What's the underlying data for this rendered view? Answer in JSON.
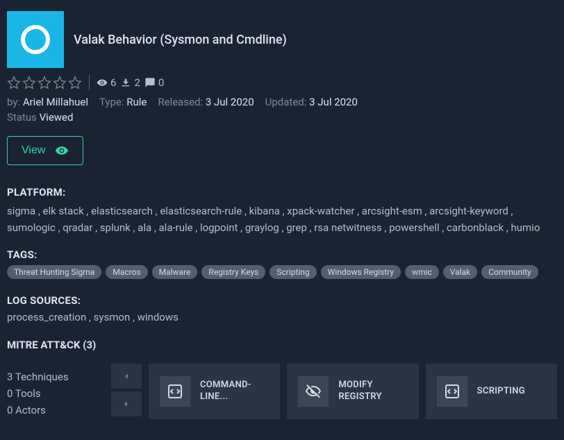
{
  "title": "Valak Behavior (Sysmon and Cmdline)",
  "rating": 0,
  "stats": {
    "views": "6",
    "downloads": "2",
    "comments": "0"
  },
  "meta": {
    "by_label": "by:",
    "author": "Ariel Millahuel",
    "type_label": "Type:",
    "type": "Rule",
    "released_label": "Released:",
    "released": "3 Jul 2020",
    "updated_label": "Updated:",
    "updated": "3 Jul 2020",
    "status_label": "Status",
    "status": "Viewed"
  },
  "view_btn": "View",
  "platform": {
    "label": "PLATFORM:",
    "text": "sigma , elk stack , elasticsearch , elasticsearch-rule , kibana , xpack-watcher , arcsight-esm , arcsight-keyword , sumologic , qradar , splunk , ala , ala-rule , logpoint , graylog , grep , rsa netwitness , powershell , carbonblack , humio"
  },
  "tags": {
    "label": "TAGS:",
    "items": [
      "Threat Hunting Sigma",
      "Macros",
      "Malware",
      "Registry Keys",
      "Scripting",
      "Windows Registry",
      "wmic",
      "Valak",
      "Community"
    ]
  },
  "log_sources": {
    "label": "LOG SOURCES:",
    "text": "process_creation , sysmon , windows"
  },
  "mitre": {
    "title": "MITRE ATT&CK (3)",
    "stats": {
      "techniques": "3 Techniques",
      "tools": "0 Tools",
      "actors": "0 Actors"
    },
    "cards": [
      {
        "label": "COMMAND-LINE...",
        "icon": "code"
      },
      {
        "label": "MODIFY REGISTRY",
        "icon": "eye-off"
      },
      {
        "label": "SCRIPTING",
        "icon": "code"
      }
    ]
  }
}
